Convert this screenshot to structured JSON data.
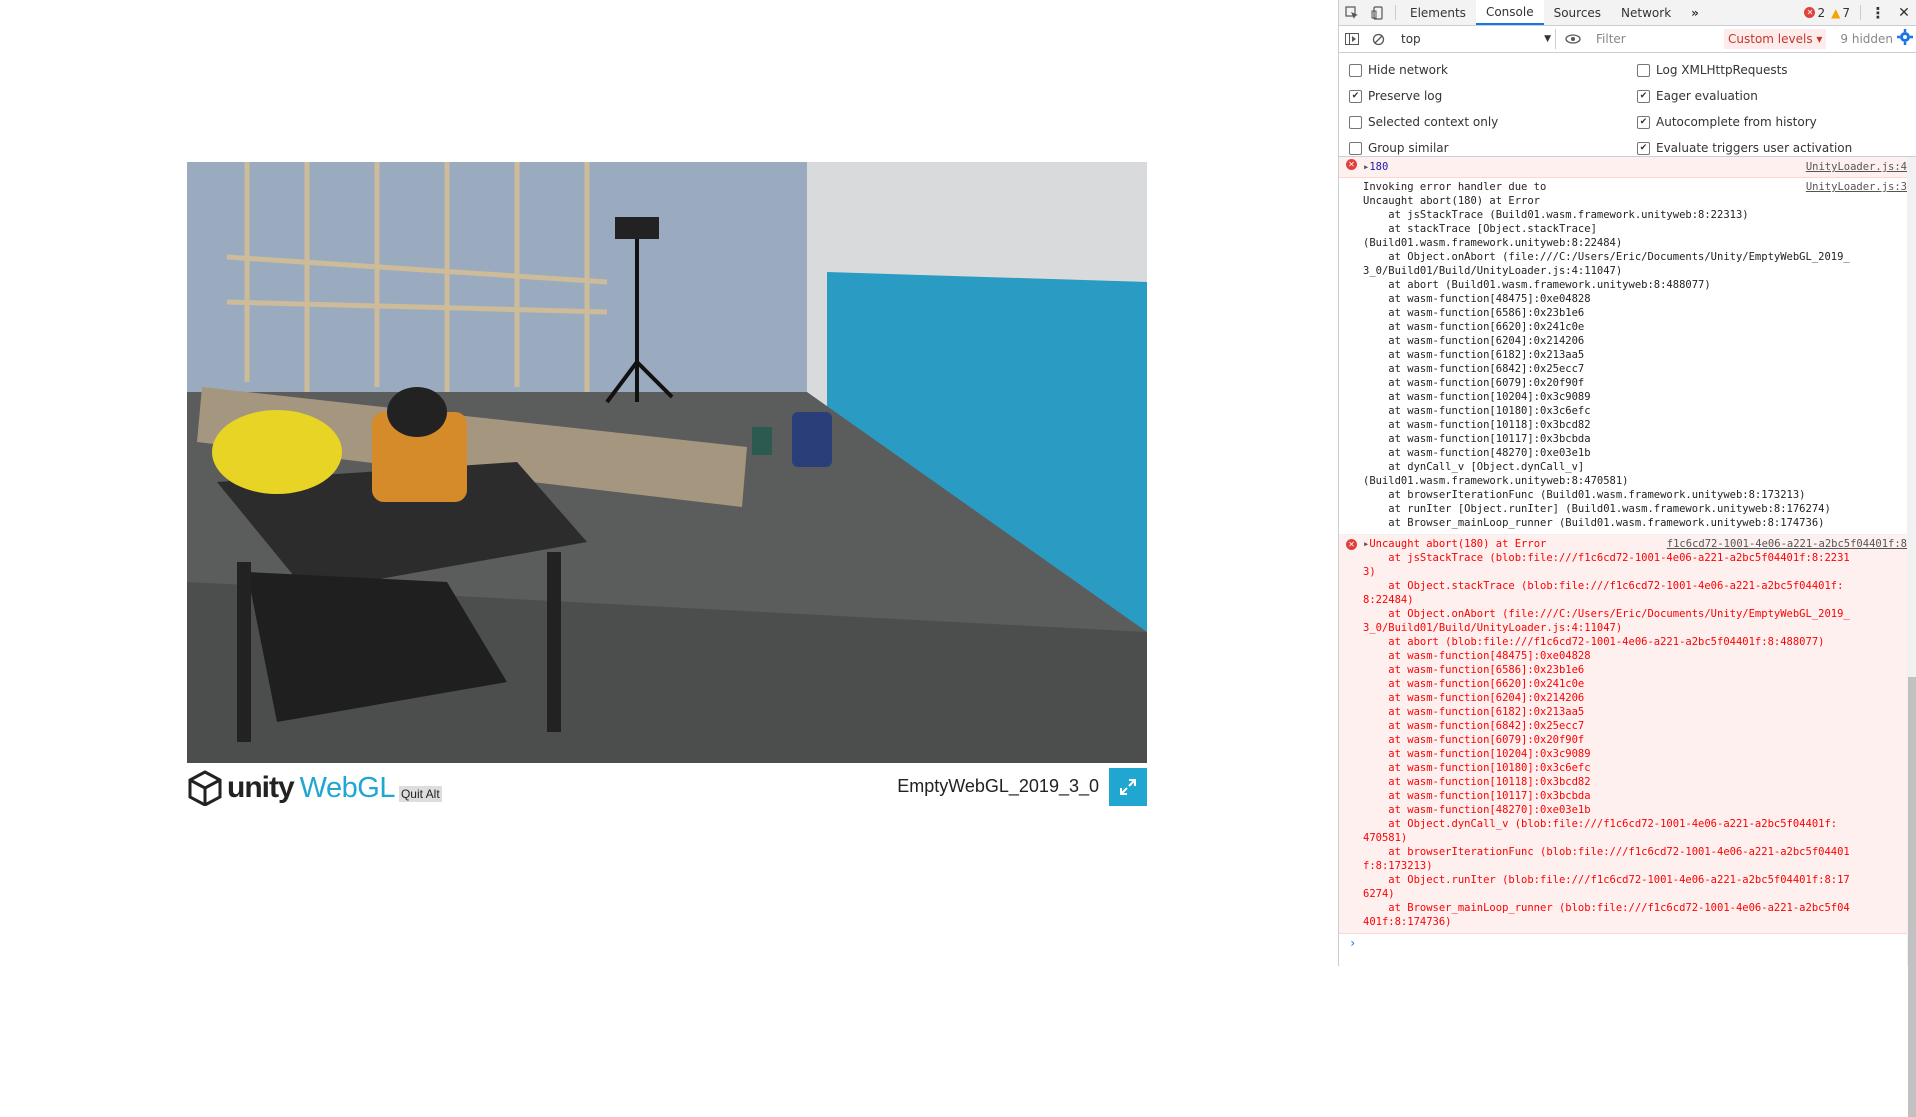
{
  "game": {
    "title": "EmptyWebGL_2019_3_0",
    "logo_unity": "unity",
    "logo_webgl": "WebGL",
    "quit_alt": "Quit Alt"
  },
  "devtools": {
    "tabs": [
      {
        "label": "Elements"
      },
      {
        "label": "Console"
      },
      {
        "label": "Sources"
      },
      {
        "label": "Network"
      }
    ],
    "error_count": "2",
    "warning_count": "7",
    "context": "top",
    "filter_placeholder": "Filter",
    "levels": "Custom levels ▾",
    "hidden": "9 hidden",
    "options_left": [
      "Hide network",
      "Preserve log",
      "Selected context only",
      "Group similar"
    ],
    "options_right": [
      "Log XMLHttpRequests",
      "Eager evaluation",
      "Autocomplete from history",
      "Evaluate triggers user activation"
    ],
    "options_left_checked": [
      false,
      true,
      false,
      false
    ],
    "options_right_checked": [
      false,
      true,
      true,
      true
    ]
  },
  "console": {
    "msg1": {
      "text": "180",
      "source": "UnityLoader.js:4"
    },
    "msg2": {
      "source": "UnityLoader.js:3",
      "lines": [
        "Invoking error handler due to",
        "Uncaught abort(180) at Error",
        "    at jsStackTrace (Build01.wasm.framework.unityweb:8:22313)",
        "    at stackTrace [Object.stackTrace]",
        "(Build01.wasm.framework.unityweb:8:22484)",
        "    at Object.onAbort (file:///C:/Users/Eric/Documents/Unity/EmptyWebGL_2019_",
        "3_0/Build01/Build/UnityLoader.js:4:11047)",
        "    at abort (Build01.wasm.framework.unityweb:8:488077)",
        "    at wasm-function[48475]:0xe04828",
        "    at wasm-function[6586]:0x23b1e6",
        "    at wasm-function[6620]:0x241c0e",
        "    at wasm-function[6204]:0x214206",
        "    at wasm-function[6182]:0x213aa5",
        "    at wasm-function[6842]:0x25ecc7",
        "    at wasm-function[6079]:0x20f90f",
        "    at wasm-function[10204]:0x3c9089",
        "    at wasm-function[10180]:0x3c6efc",
        "    at wasm-function[10118]:0x3bcd82",
        "    at wasm-function[10117]:0x3bcbda",
        "    at wasm-function[48270]:0xe03e1b",
        "    at dynCall_v [Object.dynCall_v]",
        "(Build01.wasm.framework.unityweb:8:470581)",
        "    at browserIterationFunc (Build01.wasm.framework.unityweb:8:173213)",
        "    at runIter [Object.runIter] (Build01.wasm.framework.unityweb:8:176274)",
        "    at Browser_mainLoop_runner (Build01.wasm.framework.unityweb:8:174736)"
      ]
    },
    "msg3": {
      "head": "Uncaught abort(180) at Error",
      "source": "f1c6cd72-1001-4e06-a221-a2bc5f04401f:8",
      "lines": [
        "    at jsStackTrace (blob:file:///f1c6cd72-1001-4e06-a221-a2bc5f04401f:8:2231",
        "3)",
        "    at Object.stackTrace (blob:file:///f1c6cd72-1001-4e06-a221-a2bc5f04401f:",
        "8:22484)",
        "    at Object.onAbort (file:///C:/Users/Eric/Documents/Unity/EmptyWebGL_2019_",
        "3_0/Build01/Build/UnityLoader.js:4:11047)",
        "    at abort (blob:file:///f1c6cd72-1001-4e06-a221-a2bc5f04401f:8:488077)",
        "    at wasm-function[48475]:0xe04828",
        "    at wasm-function[6586]:0x23b1e6",
        "    at wasm-function[6620]:0x241c0e",
        "    at wasm-function[6204]:0x214206",
        "    at wasm-function[6182]:0x213aa5",
        "    at wasm-function[6842]:0x25ecc7",
        "    at wasm-function[6079]:0x20f90f",
        "    at wasm-function[10204]:0x3c9089",
        "    at wasm-function[10180]:0x3c6efc",
        "    at wasm-function[10118]:0x3bcd82",
        "    at wasm-function[10117]:0x3bcbda",
        "    at wasm-function[48270]:0xe03e1b",
        "    at Object.dynCall_v (blob:file:///f1c6cd72-1001-4e06-a221-a2bc5f04401f:",
        "470581)",
        "    at browserIterationFunc (blob:file:///f1c6cd72-1001-4e06-a221-a2bc5f04401",
        "f:8:173213)",
        "    at Object.runIter (blob:file:///f1c6cd72-1001-4e06-a221-a2bc5f04401f:8:17",
        "6274)",
        "    at Browser_mainLoop_runner (blob:file:///f1c6cd72-1001-4e06-a221-a2bc5f04",
        "401f:8:174736)"
      ]
    },
    "prompt": "›"
  }
}
